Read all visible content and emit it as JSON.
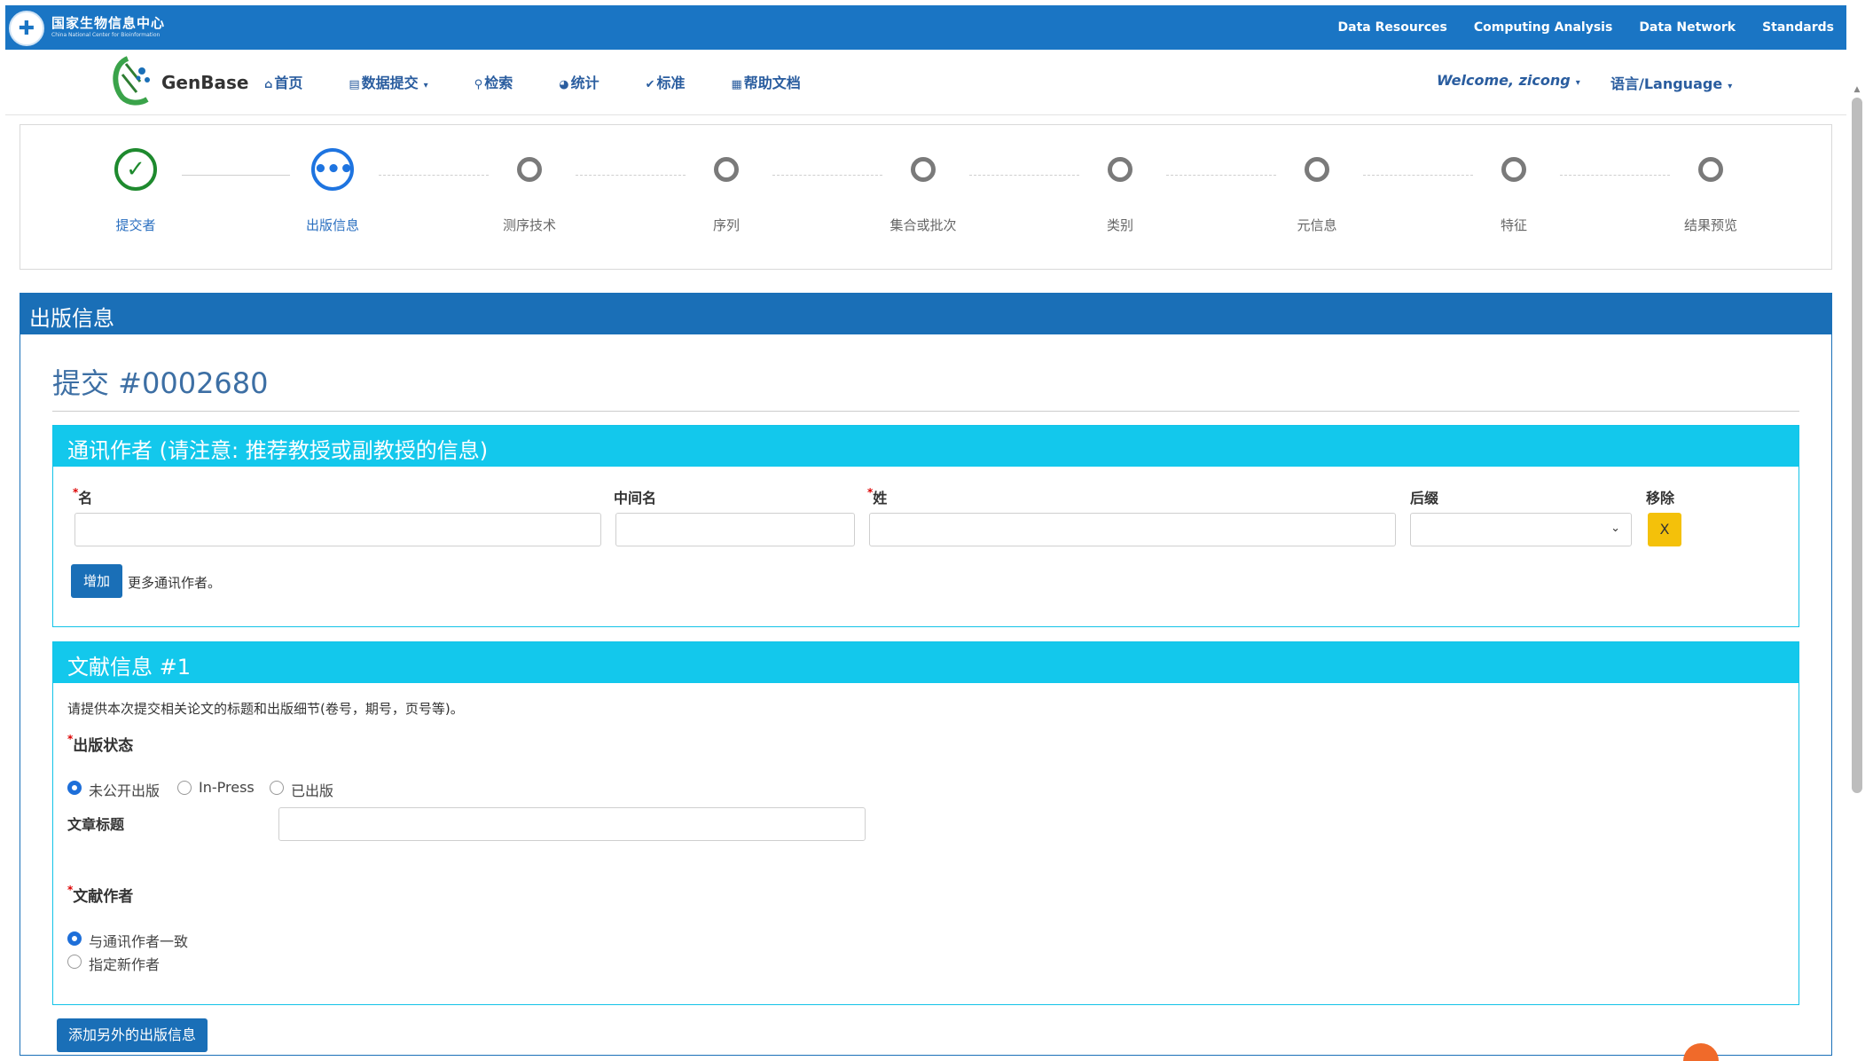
{
  "topbar": {
    "org_name": "国家生物信息中心",
    "org_name_en": "China National Center for Bioinformation",
    "links": [
      "Data Resources",
      "Computing Analysis",
      "Data Network",
      "Standards"
    ]
  },
  "nav": {
    "brand": "GenBase",
    "menu": [
      {
        "icon": "home-icon",
        "label": "首页"
      },
      {
        "icon": "file-icon",
        "label": "数据提交"
      },
      {
        "icon": "binoculars-icon",
        "label": "检索"
      },
      {
        "icon": "pie-chart-icon",
        "label": "统计"
      },
      {
        "icon": "check-circle-icon",
        "label": "标准"
      },
      {
        "icon": "document-icon",
        "label": "帮助文档"
      }
    ],
    "welcome": "Welcome, zicong",
    "language": "语言/Language"
  },
  "steps": [
    {
      "label": "提交者",
      "state": "done"
    },
    {
      "label": "出版信息",
      "state": "active"
    },
    {
      "label": "测序技术",
      "state": "todo"
    },
    {
      "label": "序列",
      "state": "todo"
    },
    {
      "label": "集合或批次",
      "state": "todo"
    },
    {
      "label": "类别",
      "state": "todo"
    },
    {
      "label": "元信息",
      "state": "todo"
    },
    {
      "label": "特征",
      "state": "todo"
    },
    {
      "label": "结果预览",
      "state": "todo"
    }
  ],
  "panel": {
    "title": "出版信息",
    "submission": "提交 #0002680"
  },
  "author_card": {
    "title": "通讯作者 (请注意: 推荐教授或副教授的信息)",
    "first_name_label": "名",
    "middle_name_label": "中间名",
    "last_name_label": "姓",
    "suffix_label": "后缀",
    "remove_label": "移除",
    "remove_button": "X",
    "add_button": "增加",
    "add_hint": "更多通讯作者。"
  },
  "pub_card": {
    "title": "文献信息 #1",
    "intro": "请提供本次提交相关论文的标题和出版细节(卷号，期号，页号等)。",
    "status_label": "出版状态",
    "status_options": [
      "未公开出版",
      "In-Press",
      "已出版"
    ],
    "status_selected": "未公开出版",
    "article_title_label": "文章标题",
    "authors_label": "文献作者",
    "author_options": [
      "与通讯作者一致",
      "指定新作者"
    ],
    "author_selected": "与通讯作者一致"
  },
  "add_pub_button": "添加另外的出版信息",
  "colors": {
    "topbar": "#1a75c4",
    "panel_header": "#1a6fb7",
    "card_header": "#13c8ec",
    "done": "#1e8a2e",
    "active": "#1e74e0",
    "remove": "#f4c10a"
  }
}
